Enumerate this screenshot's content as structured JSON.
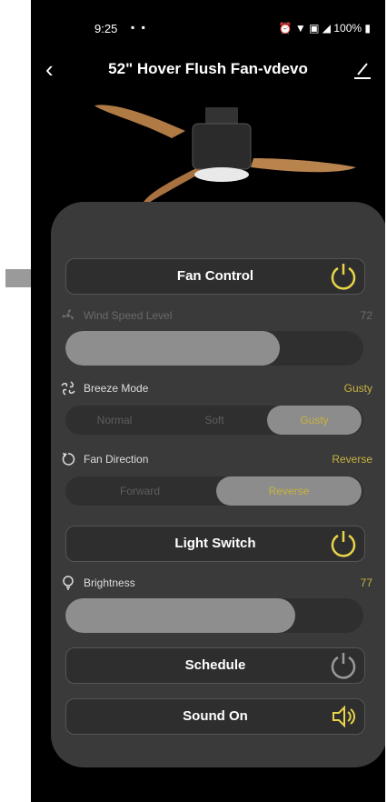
{
  "status": {
    "time": "9:25",
    "battery": "100%"
  },
  "header": {
    "title": "52\" Hover Flush Fan-vdevo"
  },
  "fan_control": {
    "label": "Fan Control"
  },
  "wind_speed": {
    "label": "Wind Speed Level",
    "value": "72",
    "level": 0.72
  },
  "breeze_mode": {
    "label": "Breeze Mode",
    "value": "Gusty",
    "options": [
      "Normal",
      "Soft",
      "Gusty"
    ],
    "selected": "Gusty"
  },
  "fan_direction": {
    "label": "Fan Direction",
    "value": "Reverse",
    "options": [
      "Forward",
      "Reverse"
    ],
    "selected": "Reverse"
  },
  "light_switch": {
    "label": "Light Switch"
  },
  "brightness": {
    "label": "Brightness",
    "value": "77",
    "level": 0.77
  },
  "schedule": {
    "label": "Schedule"
  },
  "sound": {
    "label": "Sound On"
  },
  "colors": {
    "accent": "#e9d44a",
    "value_text": "#c8b23e",
    "card": "#3a3a3a",
    "background": "#000000"
  },
  "icons": [
    "back-arrow-icon",
    "edit-pencil-icon",
    "power-icon",
    "fan-icon",
    "breeze-icon",
    "rotate-icon",
    "bulb-icon",
    "speaker-icon",
    "pointer-arrow-icon"
  ]
}
